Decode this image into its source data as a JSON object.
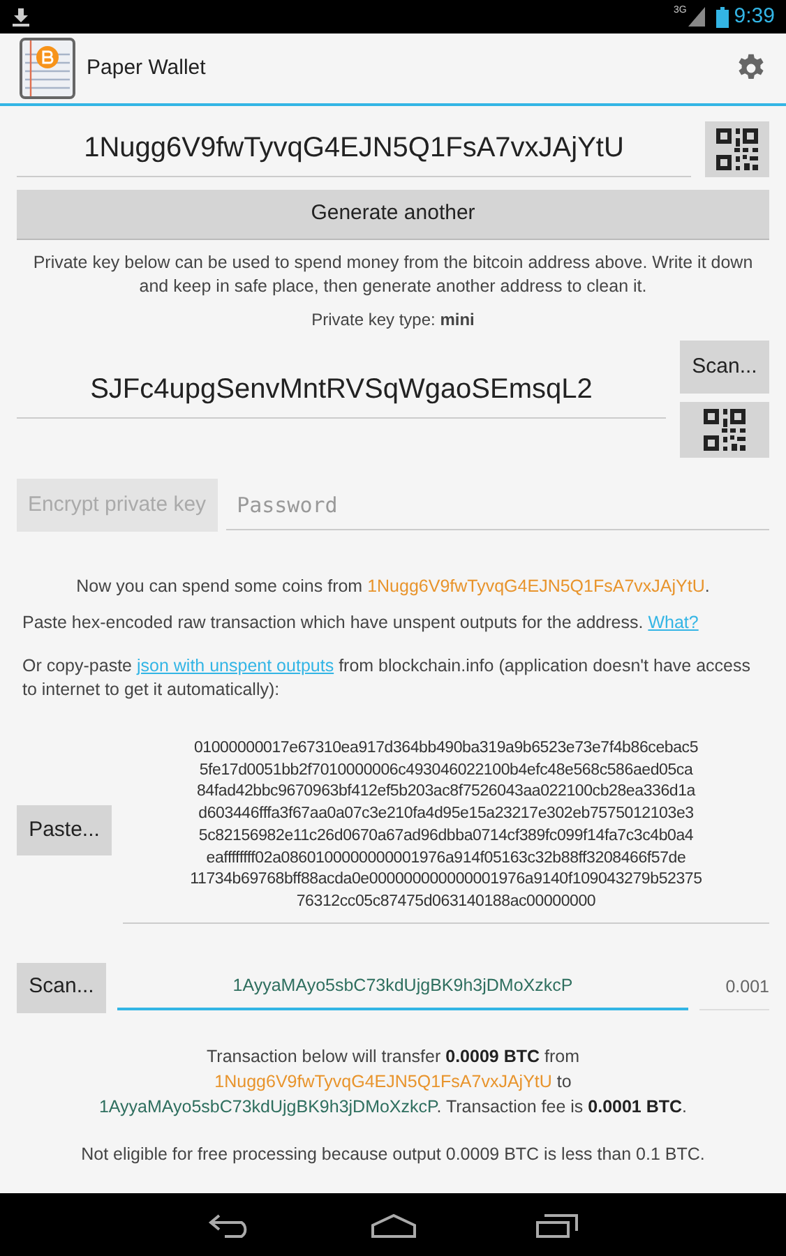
{
  "status_bar": {
    "time": "9:39",
    "network": "3G"
  },
  "app_bar": {
    "title": "Paper Wallet"
  },
  "address": {
    "value": "1Nugg6V9fwTyvqG4EJN5Q1FsA7vxJAjYtU"
  },
  "generate_button": "Generate another",
  "private_key_note": "Private key below can be used to spend money from the bitcoin address above. Write it down and keep in safe place, then generate another address to clean it.",
  "private_key_type": "Private key type: **mini**",
  "private_key": {
    "value": "SJFc4upgSenvMntRVSqWgaoSEmsqL2",
    "scan_button": "Scan..."
  },
  "encrypt": {
    "button": "Encrypt private key",
    "disabled": true,
    "password_placeholder": "Password"
  },
  "spend_note": [
    {
      "kind": "text",
      "text": "Now you can spend some coins from "
    },
    {
      "kind": "from",
      "text": "1Nugg6V9fwTyvqG4EJN5Q1FsA7vxJAjYtU"
    },
    {
      "kind": "text",
      "text": "."
    }
  ],
  "paste_note": {
    "text": "Paste hex-encoded raw transaction which have unspent outputs for the address.",
    "link": "What?"
  },
  "json_note": {
    "before": "Or copy-paste",
    "link": "json with unspent outputs",
    "after": "from blockchain.info (application doesn't have access to internet to get it automatically):"
  },
  "raw_transaction": {
    "paste_button": "Paste...",
    "lines": [
      "01000000017e67310ea917d364bb490ba319a9b6523e73e7f4b86cebac5",
      "5fe17d0051bb2f7010000006c493046022100b4efc48e568c586aed05ca",
      "84fad42bbc9670963bf412ef5b203ac8f7526043aa022100cb28ea336d1a",
      "d603446fffa3f67aa0a07c3e210fa4d95e15a23217e302eb7575012103e3",
      "5c82156982e11c26d0670a67ad96dbba0714cf389fc099f14fa7c3c4b0a4",
      "eaffffffff02a0860100000000001976a914f05163c32b88ff3208466f57de",
      "11734b69768bff88acda0e000000000000001976a9140f109043279b52375",
      "76312cc05c87475d063140188ac00000000"
    ]
  },
  "recipient": {
    "scan_button": "Scan...",
    "address": "1AyyaMAyo5sbC73kdUjgBK9h3jDMoXzkcP",
    "focused": true,
    "amount": "0.001"
  },
  "transfer_note": [
    {
      "kind": "text",
      "text": "Transaction below will transfer "
    },
    {
      "kind": "bold",
      "text": "0.0009 BTC"
    },
    {
      "kind": "text",
      "text": " from "
    },
    {
      "kind": "from",
      "text": "1Nugg6V9fwTyvqG4EJN5Q1FsA7vxJAjYtU"
    },
    {
      "kind": "text",
      "text": " to "
    },
    {
      "kind": "to",
      "text": "1AyyaMAyo5sbC73kdUjgBK9h3jDMoXzkcP"
    },
    {
      "kind": "text",
      "text": ". Transaction fee is "
    },
    {
      "kind": "bold",
      "text": "0.0001 BTC"
    },
    {
      "kind": "text",
      "text": "."
    }
  ],
  "eligibility_note": "Not eligible for free processing because output 0.0009 BTC is less than 0.1 BTC."
}
